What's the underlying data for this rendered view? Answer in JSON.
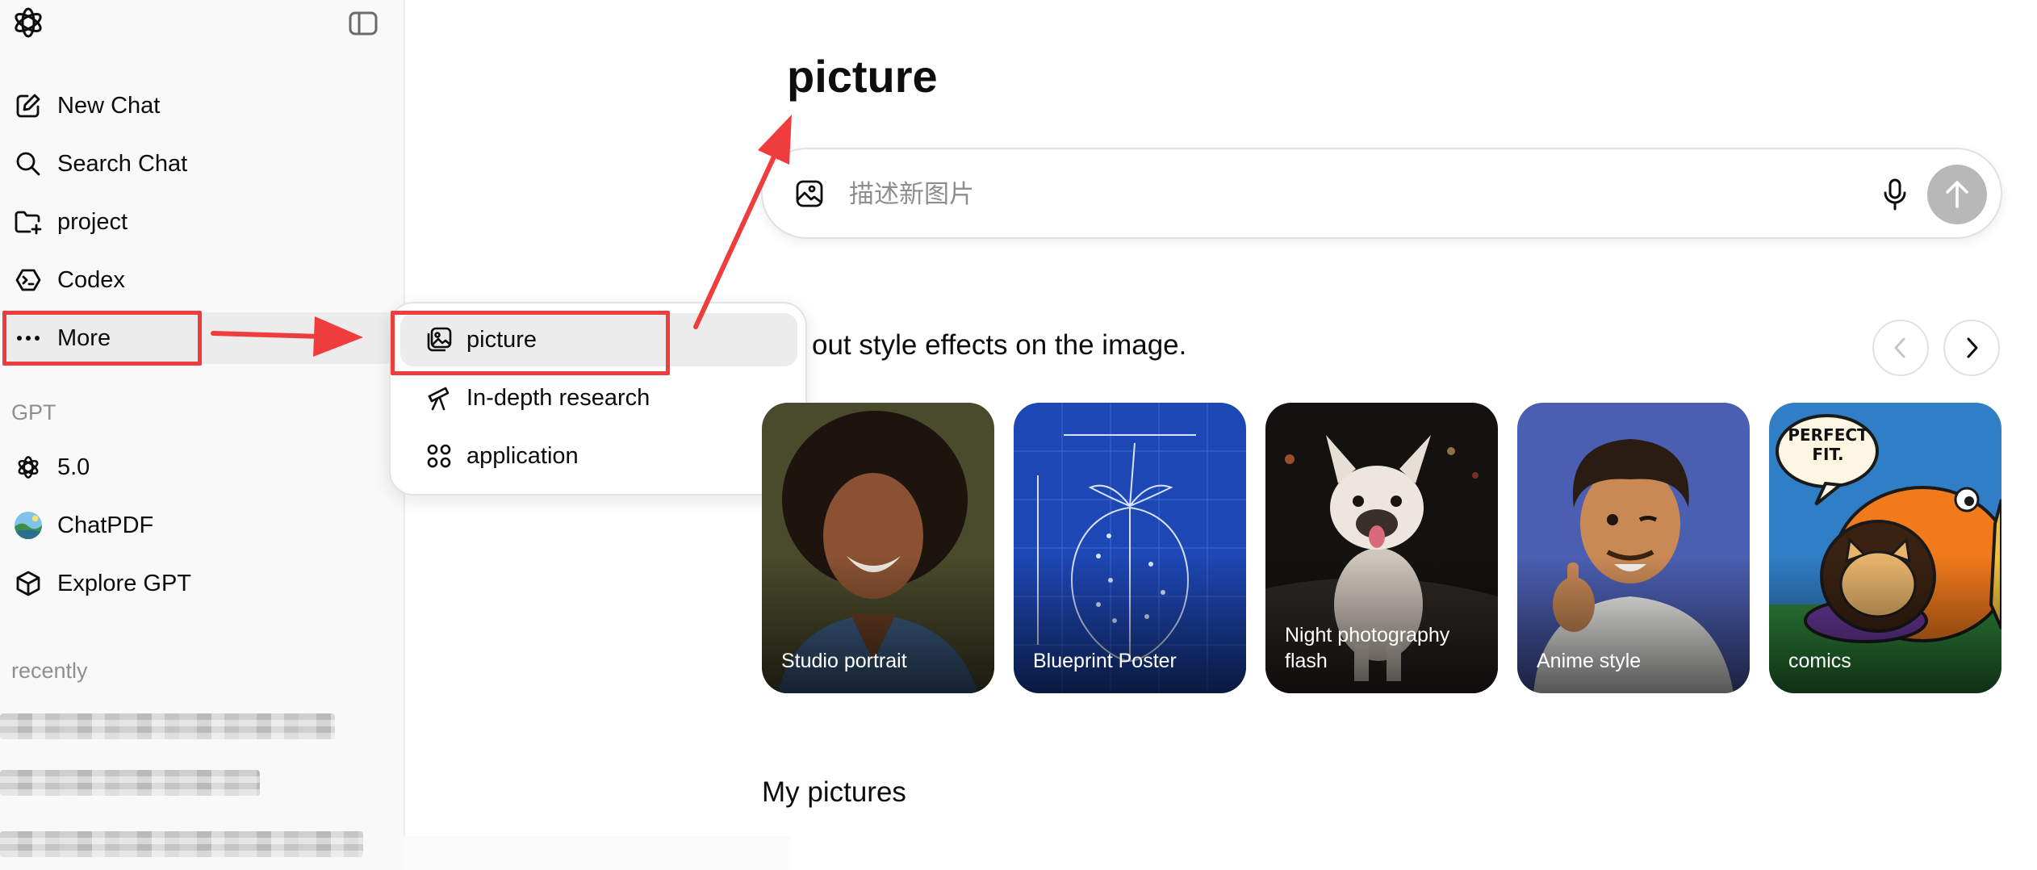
{
  "sidebar": {
    "nav": [
      {
        "label": "New Chat",
        "icon": "edit-icon"
      },
      {
        "label": "Search Chat",
        "icon": "search-icon"
      },
      {
        "label": "project",
        "icon": "folder-plus-icon"
      },
      {
        "label": "Codex",
        "icon": "codex-icon"
      },
      {
        "label": "More",
        "icon": "ellipsis-icon"
      }
    ],
    "gpt_section_label": "GPT",
    "gpts": [
      {
        "label": "5.0",
        "icon": "openai-logo-icon"
      },
      {
        "label": "ChatPDF",
        "icon": "chatpdf-avatar"
      },
      {
        "label": "Explore GPT",
        "icon": "cube-icon"
      }
    ],
    "recent_section_label": "recently"
  },
  "more_menu": {
    "items": [
      {
        "label": "picture",
        "icon": "image-stack-icon"
      },
      {
        "label": "In-depth research",
        "icon": "telescope-icon"
      },
      {
        "label": "application",
        "icon": "grid-apps-icon"
      }
    ]
  },
  "main": {
    "title": "picture",
    "composer": {
      "placeholder": "描述新图片"
    },
    "styles_heading": "out style effects on the image.",
    "style_cards": [
      {
        "label": "Studio portrait"
      },
      {
        "label": "Blueprint Poster"
      },
      {
        "label": "Night photography flash"
      },
      {
        "label": "Anime style"
      },
      {
        "label": "comics"
      }
    ],
    "comic_bubble_text": "PERFECT FIT.",
    "my_pictures_title": "My pictures"
  },
  "colors": {
    "annotation_red": "#ef3d3d",
    "sidebar_bg": "#f9f9f9",
    "send_button": "#b8b8b8"
  }
}
